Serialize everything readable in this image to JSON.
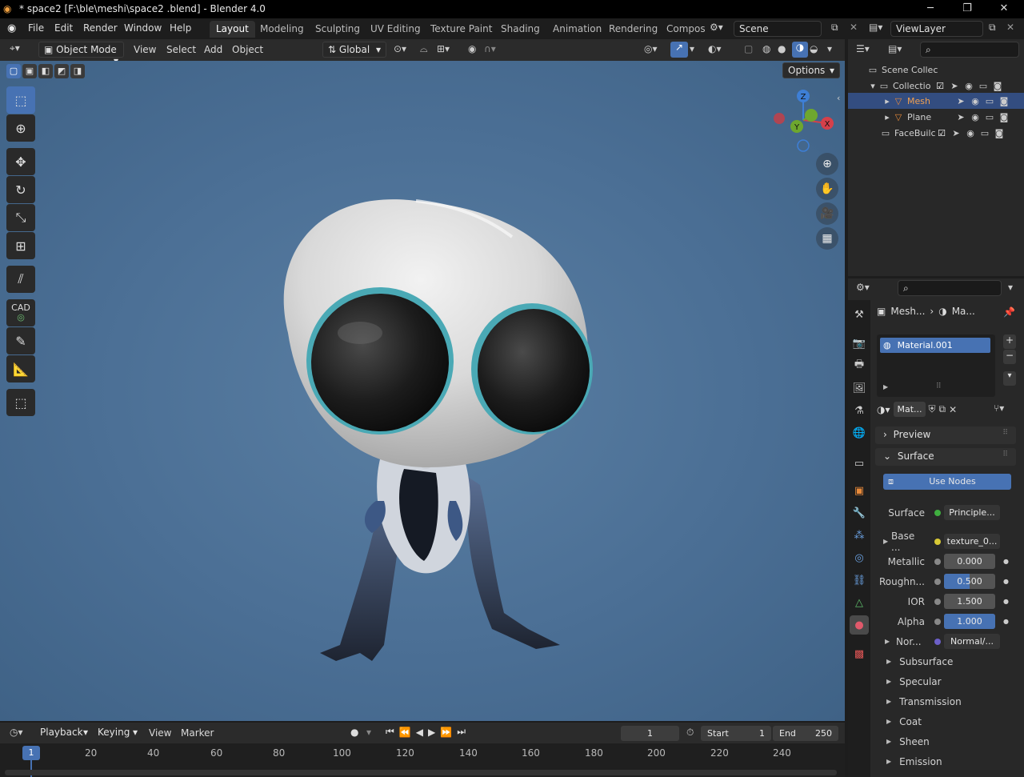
{
  "window": {
    "title": "* space2  [F:\\ble\\meshi\\space2 .blend] - Blender 4.0",
    "minimize": "─",
    "maximize": "❐",
    "close": "✕"
  },
  "menu": [
    "File",
    "Edit",
    "Render",
    "Window",
    "Help"
  ],
  "workspaces": [
    "Layout",
    "Modeling",
    "Sculpting",
    "UV Editing",
    "Texture Paint",
    "Shading",
    "Animation",
    "Rendering",
    "Compos"
  ],
  "active_workspace": "Layout",
  "scene": {
    "name": "Scene",
    "view_layer": "ViewLayer"
  },
  "viewport": {
    "mode": "Object Mode",
    "menus": [
      "View",
      "Select",
      "Add",
      "Object"
    ],
    "orientation": "Global",
    "options_label": "Options",
    "gizmo": {
      "z": "Z",
      "y": "Y",
      "x": "X"
    },
    "tools": [
      "select-box",
      "cursor",
      "move",
      "rotate",
      "scale",
      "transform",
      "annotate-lines",
      "cad",
      "annotate",
      "measure",
      "add-cube"
    ],
    "cad_label": "CAD",
    "background_color": "#4b6f95"
  },
  "outliner": {
    "rows": [
      {
        "label": "Scene Collec",
        "indent": 0
      },
      {
        "label": "Collectio",
        "indent": 1
      },
      {
        "label": "Mesh",
        "indent": 2,
        "selected": true
      },
      {
        "label": "Plane",
        "indent": 2
      },
      {
        "label": "FaceBuilc",
        "indent": 1
      }
    ]
  },
  "properties": {
    "breadcrumb": [
      "Mesh...",
      "Ma..."
    ],
    "material_slot": "Material.001",
    "material_name": "Mat...",
    "sections": {
      "preview": "Preview",
      "surface": "Surface"
    },
    "use_nodes": "Use Nodes",
    "fields": [
      {
        "label": "Surface",
        "value": "Principle...",
        "socket": "#3fae3f",
        "type": "link"
      },
      {
        "label": "Base ...",
        "value": "texture_0...",
        "socket": "#d8c936",
        "type": "link"
      },
      {
        "label": "Metallic",
        "value": "0.000",
        "type": "num",
        "fill": 0.0
      },
      {
        "label": "Roughn...",
        "value": "0.500",
        "type": "num",
        "fill": 0.5
      },
      {
        "label": "IOR",
        "value": "1.500",
        "type": "num",
        "fill": 0.0
      },
      {
        "label": "Alpha",
        "value": "1.000",
        "type": "num",
        "fill": 1.0
      },
      {
        "label": "Nor...",
        "value": "Normal/...",
        "socket": "#6c5fc7",
        "type": "link"
      }
    ],
    "subpanels": [
      "Subsurface",
      "Specular",
      "Transmission",
      "Coat",
      "Sheen",
      "Emission"
    ]
  },
  "timeline": {
    "menus": [
      "Playback",
      "Keying",
      "View",
      "Marker"
    ],
    "current_frame": "1",
    "start_label": "Start",
    "start": "1",
    "end_label": "End",
    "end": "250",
    "ticks": [
      "20",
      "40",
      "60",
      "80",
      "100",
      "120",
      "140",
      "160",
      "180",
      "200",
      "220",
      "240"
    ],
    "playhead": "1"
  }
}
